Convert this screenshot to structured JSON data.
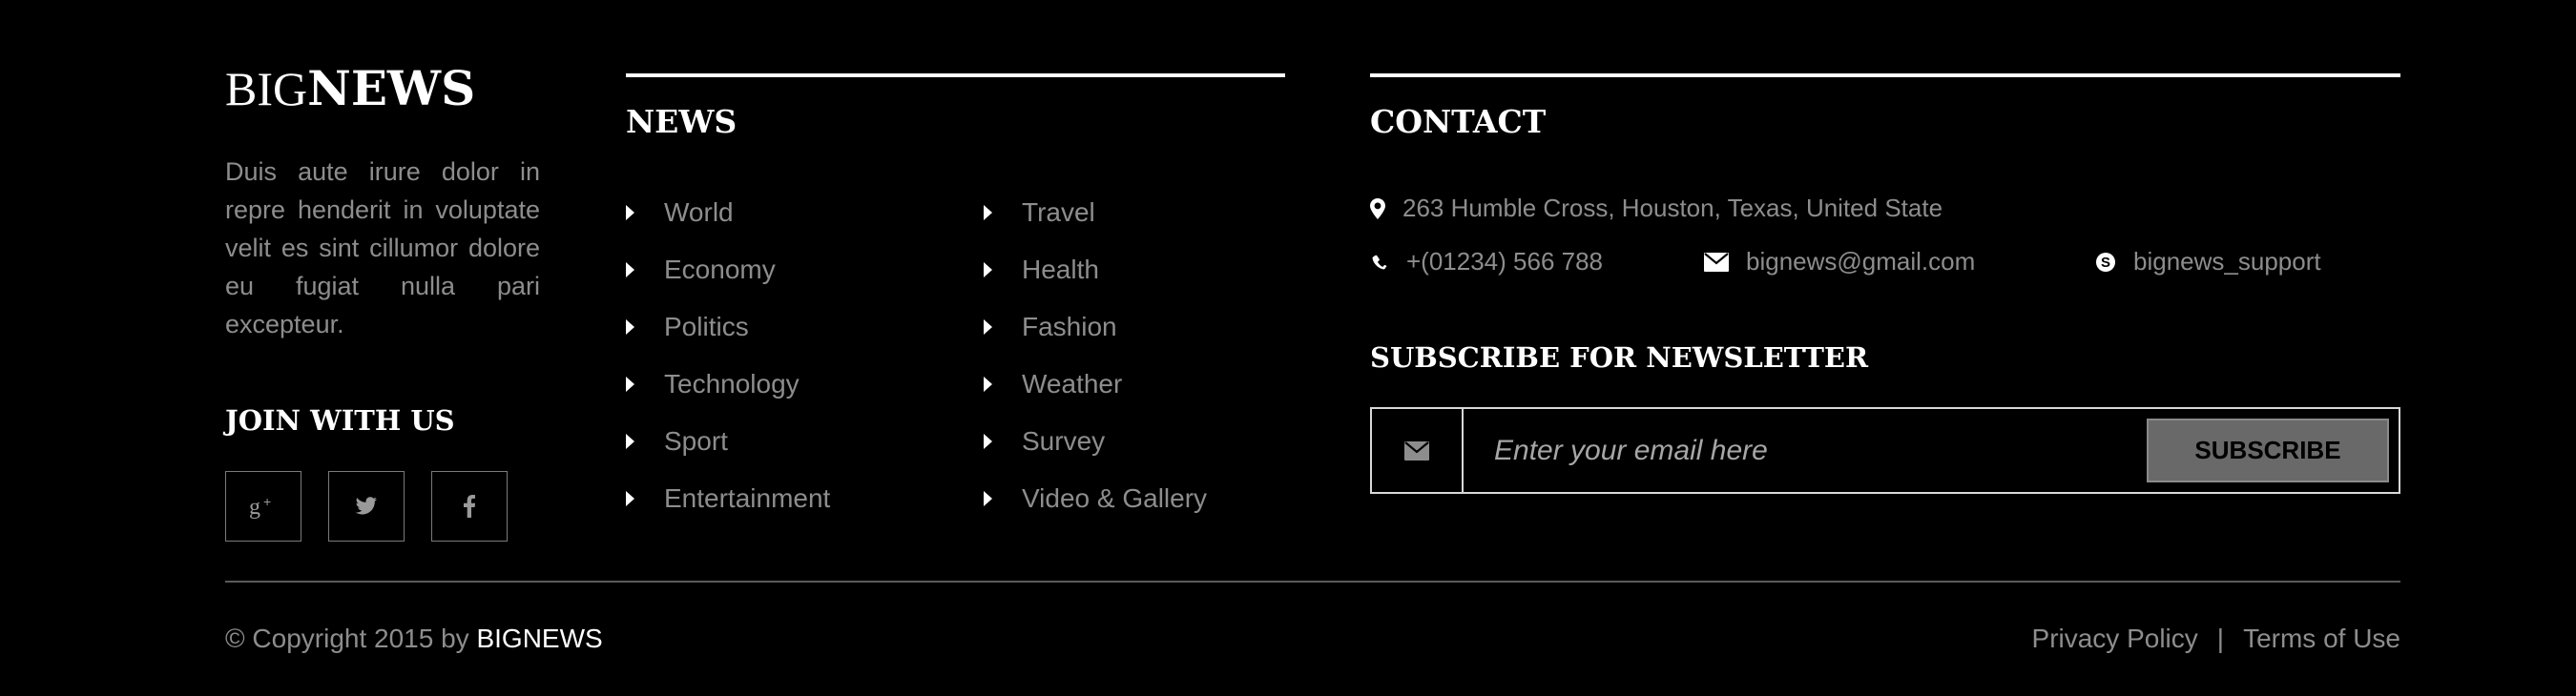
{
  "brand": {
    "logo_thin": "BIG",
    "logo_bold": "NEWS"
  },
  "about": {
    "text": "Duis aute irure dolor in repre henderit in voluptate velit es sint cillumor dolore eu fugiat nulla pari excepteur."
  },
  "join": {
    "title": "JOIN WITH US",
    "socials": [
      "google-plus-icon",
      "twitter-icon",
      "facebook-icon"
    ]
  },
  "news": {
    "title": "NEWS",
    "left": [
      "World",
      "Economy",
      "Politics",
      "Technology",
      "Sport",
      "Entertainment"
    ],
    "right": [
      "Travel",
      "Health",
      "Fashion",
      "Weather",
      "Survey",
      "Video & Gallery"
    ]
  },
  "contact": {
    "title": "CONTACT",
    "address": "263 Humble Cross, Houston, Texas, United State",
    "phone": "+(01234) 566 788",
    "email": "bignews@gmail.com",
    "skype": "bignews_support"
  },
  "newsletter": {
    "title": "SUBSCRIBE FOR NEWSLETTER",
    "placeholder": "Enter your email here",
    "button": "SUBSCRIBE"
  },
  "bottom": {
    "copyright_prefix": "© Copyright 2015 by ",
    "copyright_brand": "BIGNEWS",
    "privacy": "Privacy Policy",
    "separator": "|",
    "terms": "Terms of Use"
  },
  "colors": {
    "background": "#000000",
    "text": "#8d8d8d",
    "heading": "#ffffff",
    "button": "#696969"
  }
}
